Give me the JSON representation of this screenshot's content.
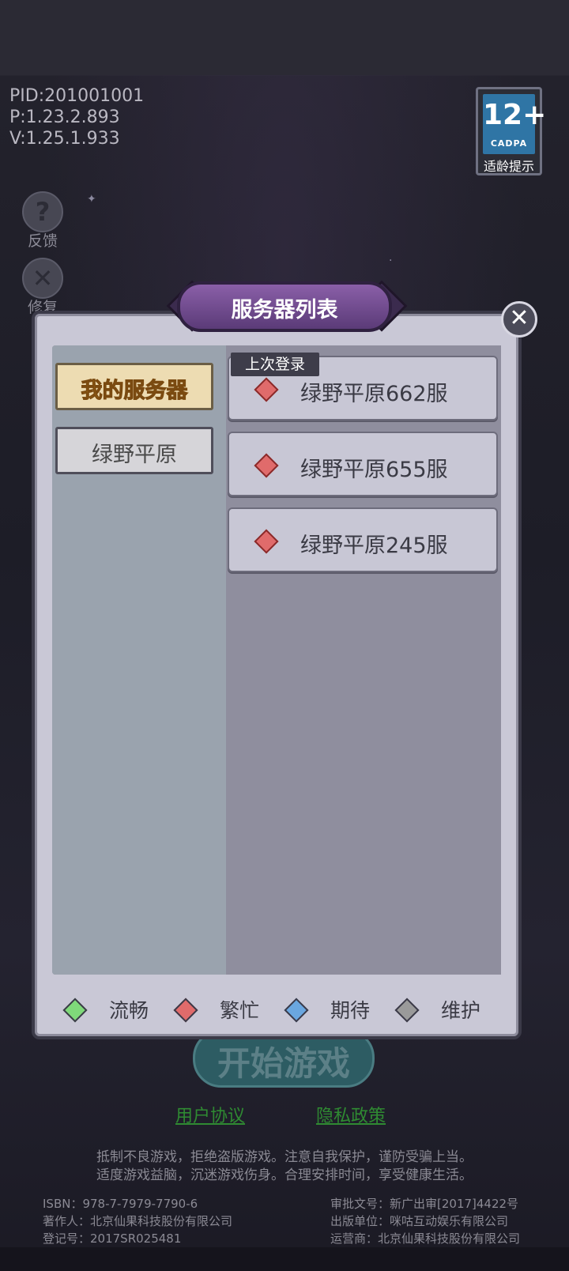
{
  "version_info": [
    "PID:201001001",
    "P:1.23.2.893",
    "V:1.25.1.933"
  ],
  "age_rating": {
    "number": "12+",
    "org": "CADPA",
    "tip": "适龄提示"
  },
  "side_buttons": [
    {
      "icon": "help-icon",
      "label": "反馈"
    },
    {
      "icon": "repair-icon",
      "label": "修复"
    }
  ],
  "modal": {
    "title": "服务器列表",
    "close_icon": "close-icon",
    "tabs": [
      "我的服务器",
      "绿野平原"
    ],
    "recent_tag": "上次登录",
    "servers": [
      {
        "name": "绿野平原662服",
        "status": "繁忙"
      },
      {
        "name": "绿野平原655服",
        "status": "繁忙"
      },
      {
        "name": "绿野平原245服",
        "status": "繁忙"
      }
    ],
    "legend": [
      {
        "label": "流畅",
        "color": "#7fd97a"
      },
      {
        "label": "繁忙",
        "color": "#e06b6b"
      },
      {
        "label": "期待",
        "color": "#6aa7e0"
      },
      {
        "label": "维护",
        "color": "#9a9a9a"
      }
    ]
  },
  "start_button": "开始游戏",
  "links": {
    "user_agreement": "用户协议",
    "privacy_policy": "隐私政策"
  },
  "notice": [
    "抵制不良游戏，拒绝盗版游戏。注意自我保护，谨防受骗上当。",
    "适度游戏益脑，沉迷游戏伤身。合理安排时间，享受健康生活。"
  ],
  "legal_left": [
    "ISBN：978-7-7979-7790-6",
    "著作人：北京仙果科技股份有限公司",
    "登记号：2017SR025481"
  ],
  "legal_right": [
    "审批文号：新广出审[2017]4422号",
    "出版单位：咪咕互动娱乐有限公司",
    "运营商：北京仙果科技股份有限公司"
  ],
  "colors": {
    "accent_busy": "#e06b6b",
    "tab_active": "#eddcb2"
  }
}
